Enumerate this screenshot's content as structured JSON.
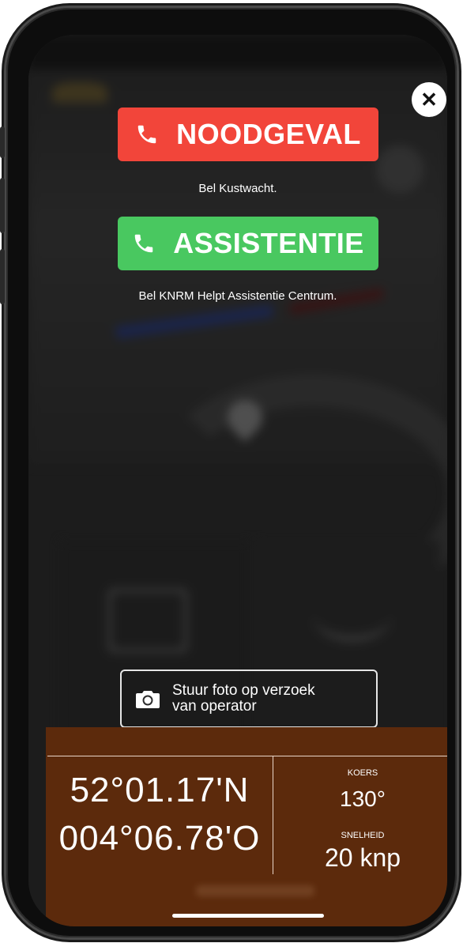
{
  "close": {
    "symbol": "✕"
  },
  "emergency": {
    "label": "NOODGEVAL",
    "caption": "Bel Kustwacht.",
    "color": "#f2453a",
    "icon": "phone-icon"
  },
  "assistance": {
    "label": "ASSISTENTIE",
    "caption": "Bel KNRM Helpt Assistentie Centrum.",
    "color": "#49c860",
    "icon": "phone-icon"
  },
  "photo_request": {
    "line1": "Stuur foto op verzoek",
    "line2": "van operator",
    "icon": "camera-icon"
  },
  "position": {
    "latitude": "52°01.17'N",
    "longitude": "004°06.78'O"
  },
  "course": {
    "label": "KOERS",
    "value": "130°"
  },
  "speed": {
    "label": "SNELHEID",
    "value": "20 knp"
  },
  "panel_color": "#5c2a0c"
}
